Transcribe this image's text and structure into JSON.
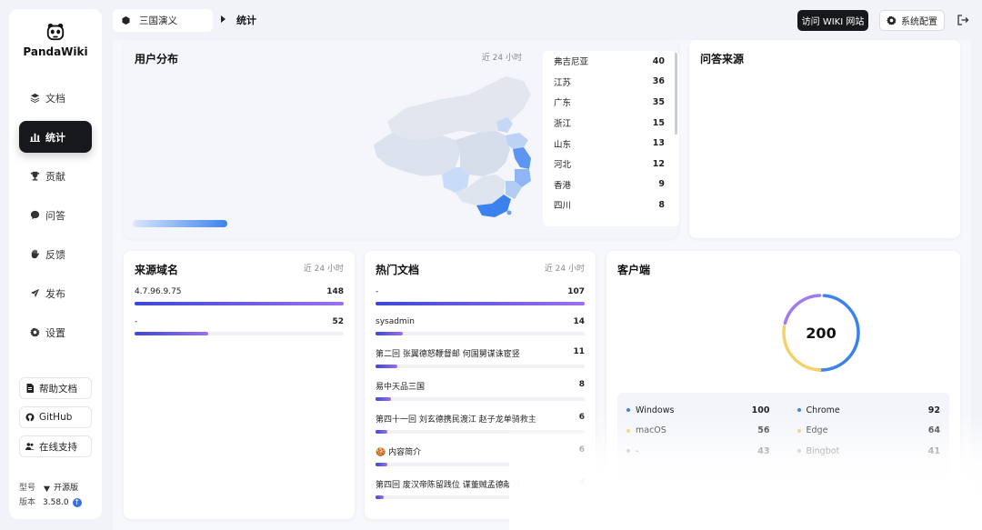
{
  "app": {
    "name": "PandaWiki"
  },
  "nav": {
    "items": [
      {
        "label": "文档",
        "icon": "layers-icon"
      },
      {
        "label": "统计",
        "icon": "chart-icon",
        "active": true
      },
      {
        "label": "贡献",
        "icon": "trophy-icon"
      },
      {
        "label": "问答",
        "icon": "chat-icon"
      },
      {
        "label": "反馈",
        "icon": "hand-icon"
      },
      {
        "label": "发布",
        "icon": "send-icon"
      },
      {
        "label": "设置",
        "icon": "gear-icon"
      }
    ]
  },
  "side_links": [
    {
      "label": "帮助文档",
      "icon": "doc-icon"
    },
    {
      "label": "GitHub",
      "icon": "github-icon"
    },
    {
      "label": "在线支持",
      "icon": "users-icon"
    }
  ],
  "meta": {
    "model_label": "型号",
    "model_value": "开源版",
    "version_label": "版本",
    "version_value": "3.58.0"
  },
  "header": {
    "kb_name": "三国演义",
    "current": "统计",
    "visit_label": "访问 WIKI 网站",
    "config_label": "系统配置"
  },
  "user_dist": {
    "title": "用户分布",
    "period": "近 24 小时",
    "regions": [
      {
        "name": "弗吉尼亚",
        "value": 40
      },
      {
        "name": "江苏",
        "value": 36
      },
      {
        "name": "广东",
        "value": 35
      },
      {
        "name": "浙江",
        "value": 15
      },
      {
        "name": "山东",
        "value": 13
      },
      {
        "name": "河北",
        "value": 12
      },
      {
        "name": "香港",
        "value": 9
      },
      {
        "name": "四川",
        "value": 8
      }
    ]
  },
  "qa_source": {
    "title": "问答来源"
  },
  "domains": {
    "title": "来源域名",
    "period": "近 24 小时",
    "items": [
      {
        "name": "4.7.96.9.75",
        "value": 148
      },
      {
        "name": "-",
        "value": 52
      }
    ]
  },
  "hot_docs": {
    "title": "热门文档",
    "period": "近 24 小时",
    "items": [
      {
        "name": "-",
        "value": 107
      },
      {
        "name": "sysadmin",
        "value": 14
      },
      {
        "name": "第二回 张翼德怒鞭督邮 何国舅谋诛宦竖",
        "value": 11
      },
      {
        "name": "易中天品三国",
        "value": 8
      },
      {
        "name": "第四十一回 刘玄德携民渡江 赵子龙单骑救主",
        "value": 6
      },
      {
        "name": "🍪 内容简介",
        "value": 6
      },
      {
        "name": "第四回 废汉帝陈留践位 谋董贼孟德献刀",
        "value": 4
      }
    ]
  },
  "clients": {
    "title": "客户端",
    "total": "200",
    "colors": {
      "blue": "#3c82ef",
      "yellow": "#f4d26b",
      "purple": "#9b6ff0"
    },
    "left": [
      {
        "name": "Windows",
        "value": 100,
        "color": "#3c82ef"
      },
      {
        "name": "macOS",
        "value": 56,
        "color": "#f4c24a"
      },
      {
        "name": "-",
        "value": 43,
        "color": "#9b6ff0"
      }
    ],
    "right": [
      {
        "name": "Chrome",
        "value": 92,
        "color": "#3c82ef"
      },
      {
        "name": "Edge",
        "value": 64,
        "color": "#f4c24a"
      },
      {
        "name": "Bingbot",
        "value": 41,
        "color": "#9b6ff0"
      }
    ]
  }
}
